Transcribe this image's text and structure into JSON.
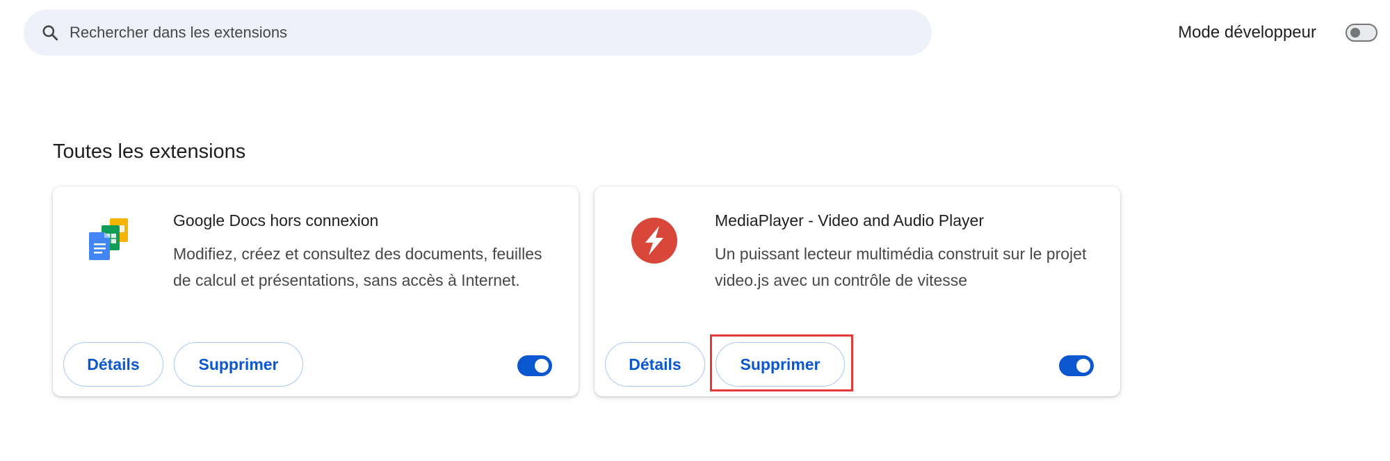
{
  "search": {
    "placeholder": "Rechercher dans les extensions",
    "icon": "search-icon"
  },
  "developer_mode": {
    "label": "Mode développeur",
    "enabled": false
  },
  "section": {
    "title": "Toutes les extensions"
  },
  "extensions": [
    {
      "name": "Google Docs hors connexion",
      "description": "Modifiez, créez et consultez des documents, feuilles de calcul et présentations, sans accès à Internet.",
      "icon": "google-docs-offline-icon",
      "details_label": "Détails",
      "remove_label": "Supprimer",
      "enabled": true
    },
    {
      "name": "MediaPlayer - Video and Audio Player",
      "description": "Un puissant lecteur multimédia construit sur le projet video.js avec un contrôle de vitesse",
      "icon": "mediaplayer-icon",
      "details_label": "Détails",
      "remove_label": "Supprimer",
      "enabled": true,
      "highlighted_action": "remove"
    }
  ],
  "colors": {
    "accent": "#0b57d0",
    "button_border": "#a8c7fa",
    "search_background": "#eef1f9",
    "highlight": "#e53935",
    "mediaplayer_brand": "#d9473b"
  }
}
